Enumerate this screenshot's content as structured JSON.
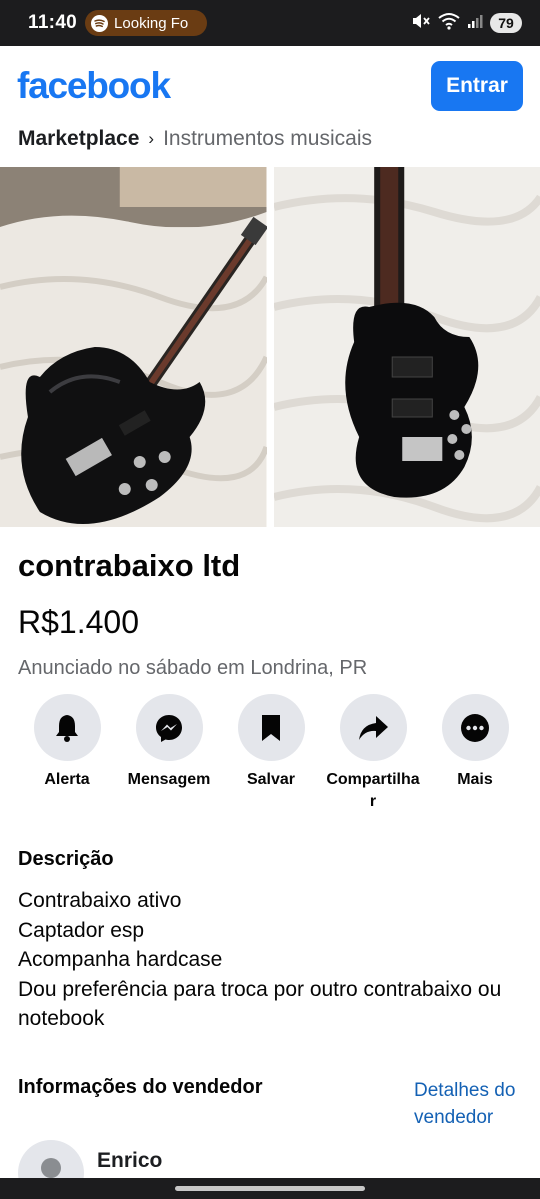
{
  "status_bar": {
    "time": "11:40",
    "spotify_text": "Looking Fo",
    "battery": "79",
    "icons": [
      "spotify-icon",
      "mute-icon",
      "wifi-icon",
      "signal-icon"
    ]
  },
  "header": {
    "logo": "facebook",
    "login_label": "Entrar",
    "brand_color": "#1877f2"
  },
  "breadcrumb": {
    "main": "Marketplace",
    "separator": "›",
    "sub": "Instrumentos musicais"
  },
  "listing": {
    "title": "contrabaixo ltd",
    "price": "R$1.400",
    "posted": "Anunciado no sábado em Londrina, PR"
  },
  "actions": [
    {
      "label": "Alerta",
      "icon": "bell-icon"
    },
    {
      "label": "Mensagem",
      "icon": "messenger-icon"
    },
    {
      "label": "Salvar",
      "icon": "bookmark-icon"
    },
    {
      "label": "Compartilhar",
      "icon": "share-icon"
    },
    {
      "label": "Mais",
      "icon": "more-icon"
    }
  ],
  "description": {
    "heading": "Descrição",
    "lines": [
      "Contrabaixo ativo",
      "Captador esp",
      "Acompanha hardcase",
      "Dou preferência para troca por outro contrabaixo ou notebook"
    ]
  },
  "seller": {
    "heading": "Informações do vendedor",
    "details_link": "Detalhes do vendedor",
    "name": "Enrico"
  }
}
